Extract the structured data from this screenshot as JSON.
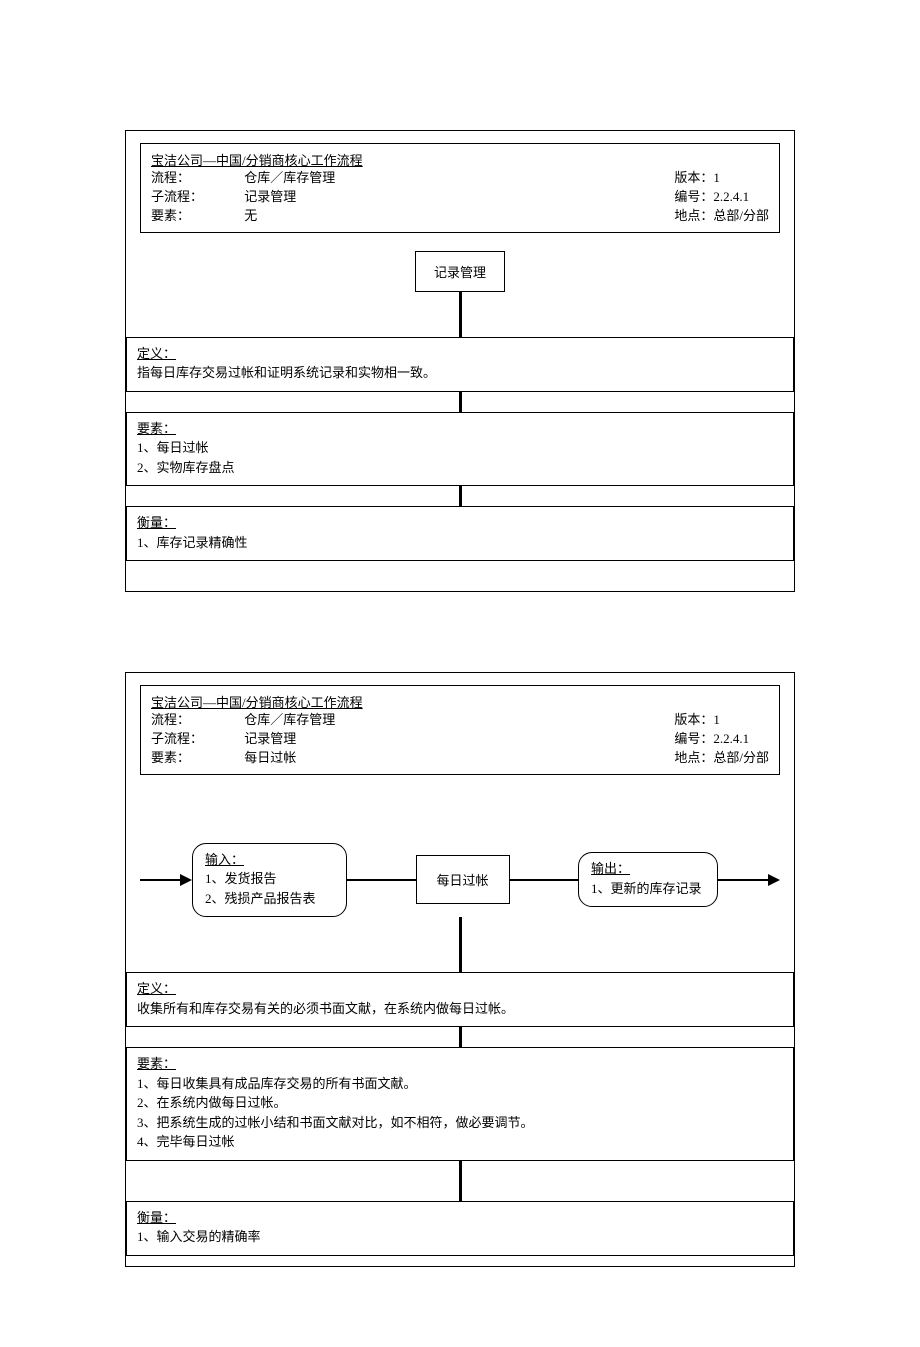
{
  "doc1": {
    "header": {
      "title": "宝洁公司—中国/分销商核心工作流程",
      "rows": {
        "process_label": "流程：",
        "process_value": "仓库／库存管理",
        "subprocess_label": "子流程：",
        "subprocess_value": "记录管理",
        "element_label": "要素：",
        "element_value": "无",
        "version_label": "版本：",
        "version_value": "1",
        "number_label": "编号：",
        "number_value": "2.2.4.1",
        "location_label": "地点：",
        "location_value": "总部/分部"
      }
    },
    "center_node": "记录管理",
    "definition": {
      "title": "定义：",
      "body": "指每日库存交易过帐和证明系统记录和实物相一致。"
    },
    "elements": {
      "title": "要素：",
      "items": [
        "1、每日过帐",
        "2、实物库存盘点"
      ]
    },
    "measure": {
      "title": "衡量：",
      "items": [
        "1、库存记录精确性"
      ]
    }
  },
  "doc2": {
    "header": {
      "title": "宝洁公司—中国/分销商核心工作流程",
      "rows": {
        "process_label": "流程：",
        "process_value": "仓库／库存管理",
        "subprocess_label": "子流程：",
        "subprocess_value": "记录管理",
        "element_label": "要素：",
        "element_value": "每日过帐",
        "version_label": "版本：",
        "version_value": "1",
        "number_label": "编号：",
        "number_value": "2.2.4.1",
        "location_label": "地点：",
        "location_value": "总部/分部"
      }
    },
    "input": {
      "title": "输入：",
      "items": [
        "1、发货报告",
        "2、残损产品报告表"
      ]
    },
    "process_node": "每日过帐",
    "output": {
      "title": "输出：",
      "items": [
        "1、更新的库存记录"
      ]
    },
    "definition": {
      "title": "定义：",
      "body": "收集所有和库存交易有关的必须书面文献，在系统内做每日过帐。"
    },
    "elements": {
      "title": "要素：",
      "items": [
        "1、每日收集具有成品库存交易的所有书面文献。",
        "2、在系统内做每日过帐。",
        "3、把系统生成的过帐小结和书面文献对比，如不相符，做必要调节。",
        "4、完毕每日过帐"
      ]
    },
    "measure": {
      "title": "衡量：",
      "items": [
        "1、输入交易的精确率"
      ]
    }
  }
}
